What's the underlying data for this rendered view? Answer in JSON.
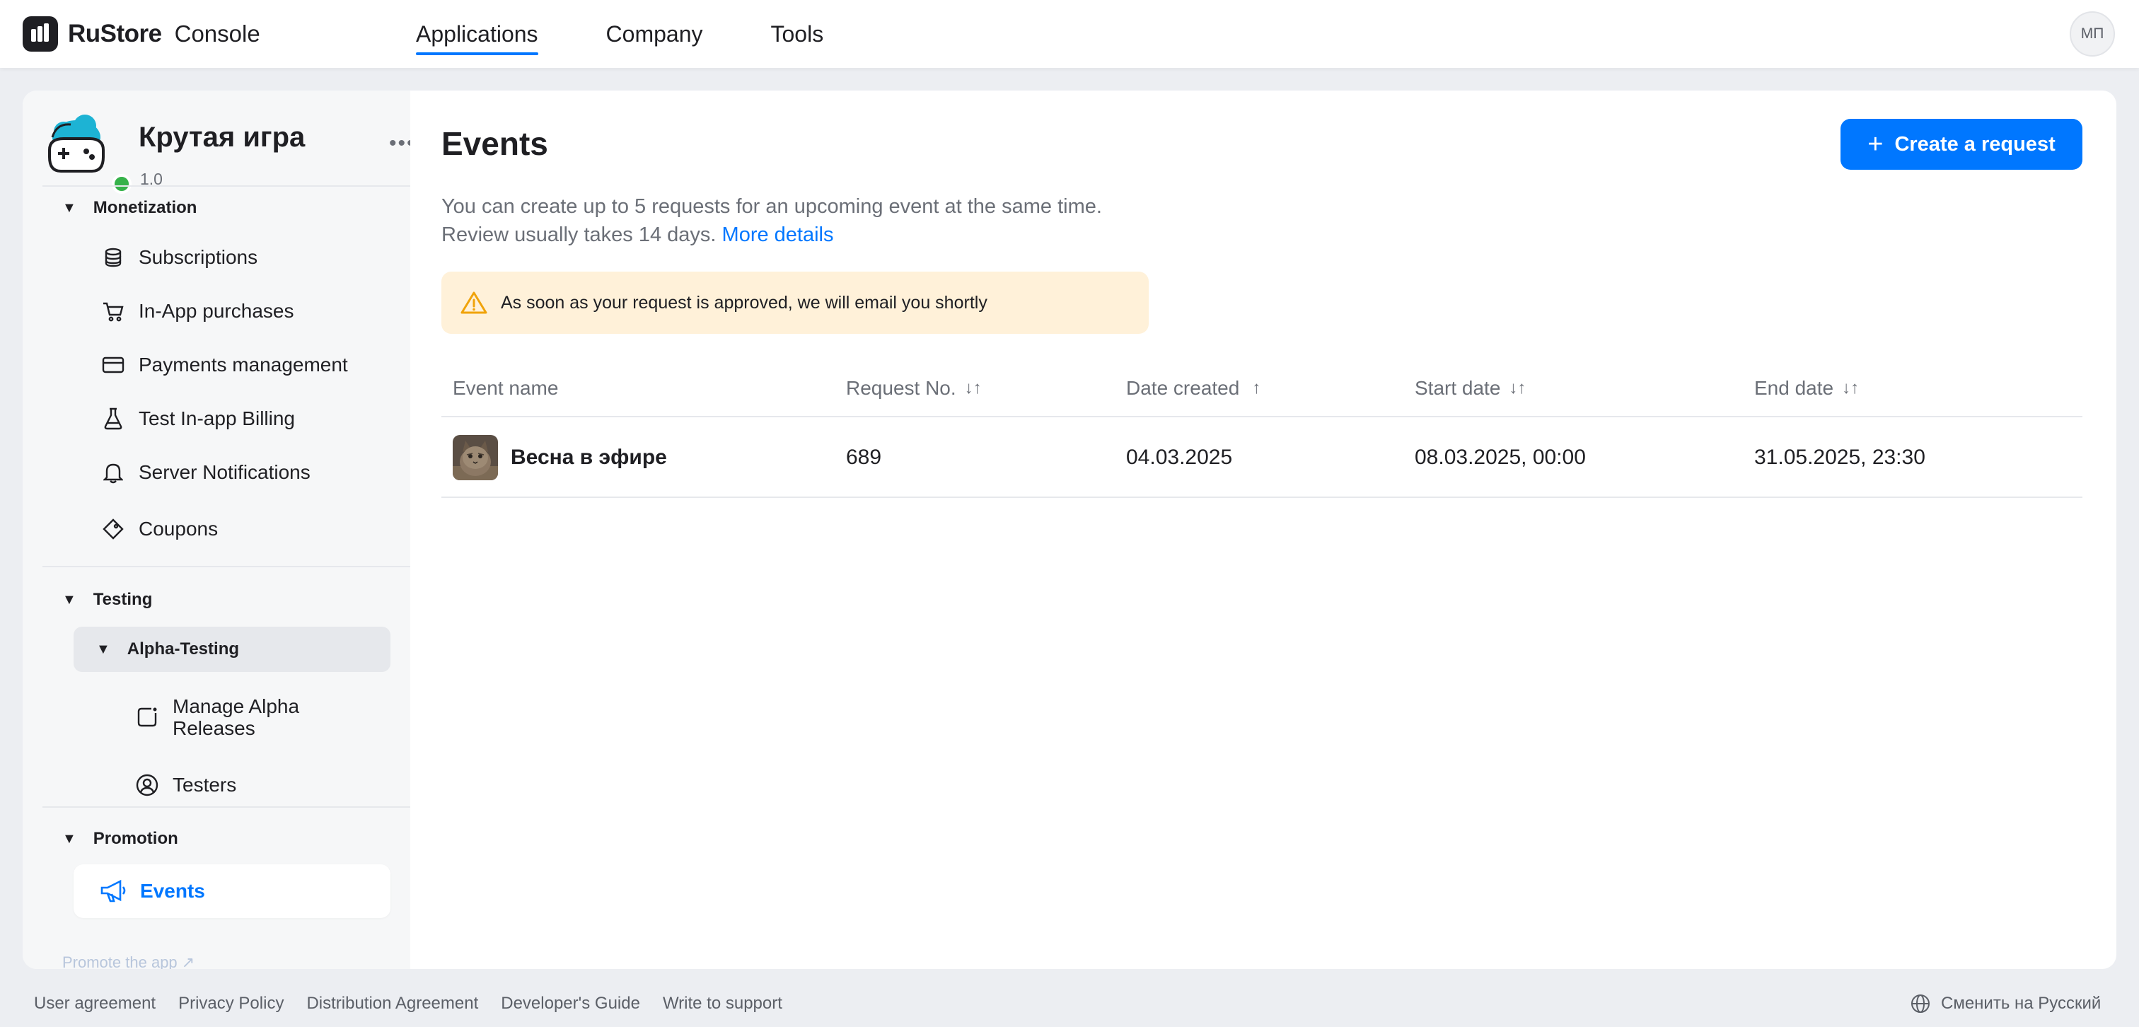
{
  "brand": {
    "name": "RuStore",
    "product": "Console"
  },
  "nav": {
    "items": [
      {
        "label": "Applications",
        "active": true
      },
      {
        "label": "Company",
        "active": false
      },
      {
        "label": "Tools",
        "active": false
      }
    ]
  },
  "user": {
    "initials": "МП"
  },
  "app": {
    "title": "Крутая игра",
    "version": "1.0",
    "status_color": "#36b24a"
  },
  "sidebar": {
    "monetization": {
      "title": "Monetization",
      "items": [
        {
          "label": "Subscriptions",
          "icon": "database-icon"
        },
        {
          "label": "In-App purchases",
          "icon": "cart-icon"
        },
        {
          "label": "Payments management",
          "icon": "card-icon"
        },
        {
          "label": "Test In-app Billing",
          "icon": "flask-icon"
        },
        {
          "label": "Server Notifications",
          "icon": "bell-icon"
        },
        {
          "label": "Coupons",
          "icon": "tag-icon"
        }
      ]
    },
    "testing": {
      "title": "Testing",
      "subgroup": "Alpha-Testing",
      "items": [
        {
          "label": "Manage Alpha Releases",
          "icon": "release-icon"
        },
        {
          "label": "Testers",
          "icon": "user-circle-icon"
        }
      ]
    },
    "promotion": {
      "title": "Promotion",
      "items": [
        {
          "label": "Events",
          "icon": "megaphone-icon",
          "active": true
        }
      ]
    },
    "faded_link": "Promote the app"
  },
  "main": {
    "title": "Events",
    "create_button": "Create a request",
    "intro_line1": "You can create up to 5 requests for an upcoming event at the same time.",
    "intro_line2": "Review usually takes 14 days.",
    "more_details": "More details",
    "notice": "As soon as your request is approved, we will email you shortly",
    "table": {
      "columns": {
        "event_name": "Event name",
        "request_no": "Request No.",
        "date_created": "Date created",
        "start_date": "Start date",
        "end_date": "End date"
      },
      "rows": [
        {
          "event_name": "Весна в эфире",
          "request_no": "689",
          "date_created": "04.03.2025",
          "start_date": "08.03.2025, 00:00",
          "end_date": "31.05.2025, 23:30"
        }
      ]
    }
  },
  "footer": {
    "links": [
      "User agreement",
      "Privacy Policy",
      "Distribution Agreement",
      "Developer's Guide",
      "Write to support"
    ],
    "language": "Сменить на Русский"
  },
  "colors": {
    "accent": "#0077ff",
    "notice_bg": "#fff1d9",
    "warning": "#f0a30a"
  }
}
